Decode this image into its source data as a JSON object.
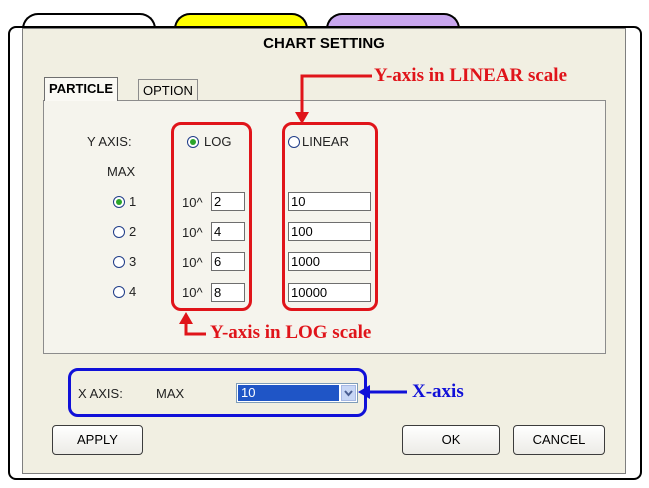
{
  "dialog": {
    "title": "CHART SETTING"
  },
  "colors": {
    "tab_yellow": "#ffff00",
    "tab_purple": "#c8a6ee",
    "annotation_red": "#e0141a",
    "annotation_blue": "#1010d8"
  },
  "tabs": [
    {
      "label": "PARTICLE",
      "active": true
    },
    {
      "label": "OPTION",
      "active": false
    }
  ],
  "y_axis": {
    "label": "Y AXIS:",
    "log_label": "LOG",
    "linear_label": "LINEAR",
    "selected": "LOG",
    "max_label": "MAX",
    "prefix": "10^",
    "rows": [
      {
        "index": "1",
        "exponent": "2",
        "linear": "10",
        "selected": true
      },
      {
        "index": "2",
        "exponent": "4",
        "linear": "100",
        "selected": false
      },
      {
        "index": "3",
        "exponent": "6",
        "linear": "1000",
        "selected": false
      },
      {
        "index": "4",
        "exponent": "8",
        "linear": "10000",
        "selected": false
      }
    ]
  },
  "x_axis": {
    "label": "X AXIS:",
    "max_label": "MAX",
    "value": "10"
  },
  "buttons": {
    "apply": "APPLY",
    "ok": "OK",
    "cancel": "CANCEL"
  },
  "annotations": {
    "linear": "Y-axis in LINEAR scale",
    "log": "Y-axis in LOG scale",
    "xaxis": "X-axis"
  }
}
